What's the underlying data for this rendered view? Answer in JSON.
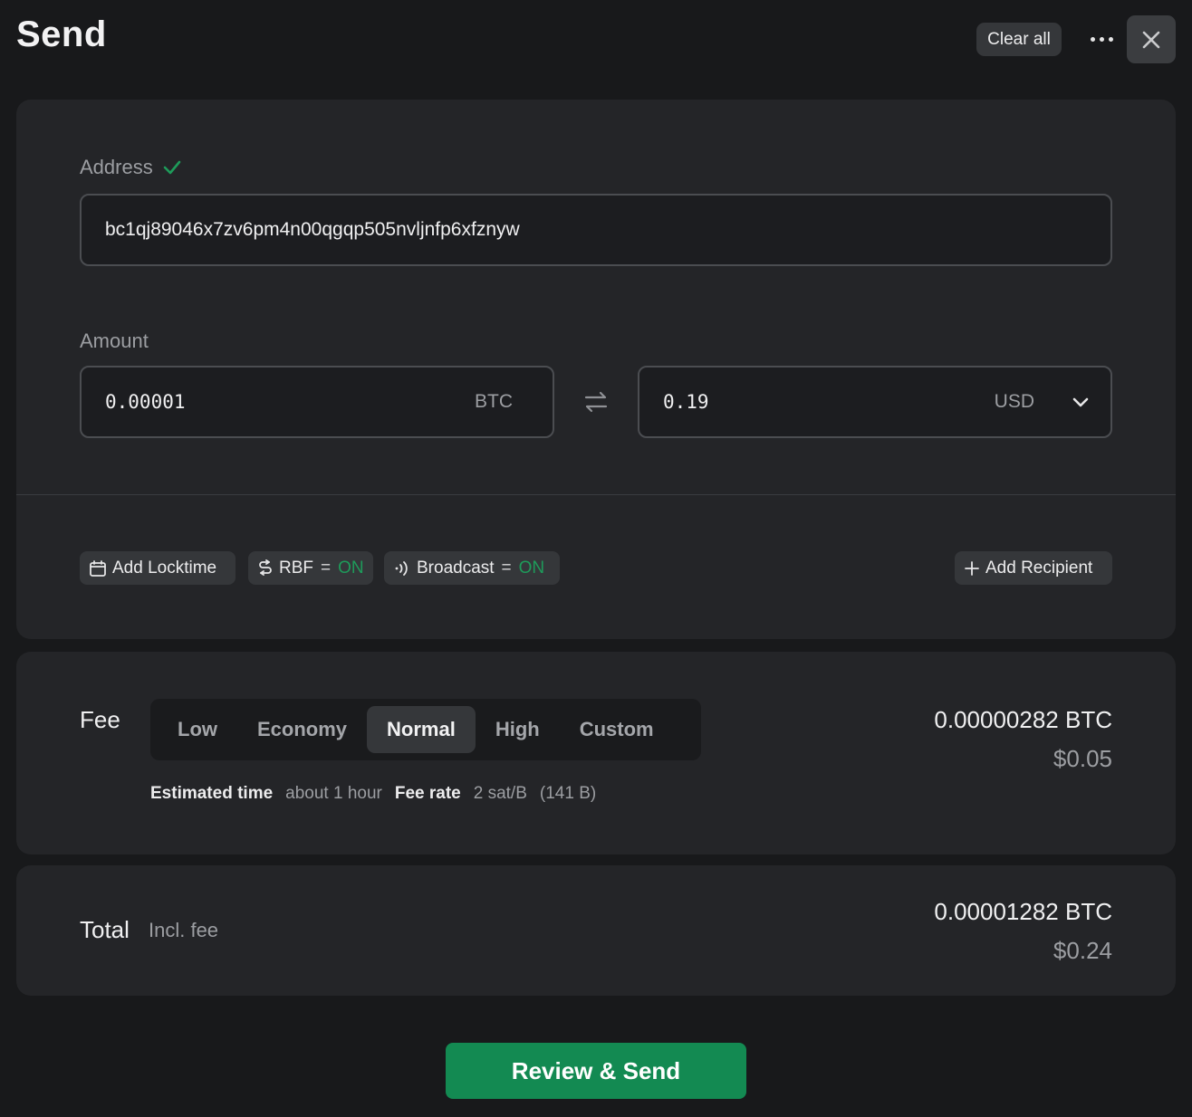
{
  "header": {
    "title": "Send",
    "clear_all_label": "Clear all"
  },
  "address": {
    "label": "Address",
    "value": "bc1qj89046x7zv6pm4n00qgqp505nvljnfp6xfznyw",
    "valid": true
  },
  "amount": {
    "label": "Amount",
    "btc_value": "0.00001",
    "btc_unit": "BTC",
    "fiat_value": "0.19",
    "fiat_unit": "USD"
  },
  "options": {
    "locktime_label": "Add Locktime",
    "rbf_label": "RBF",
    "rbf_eq": "=",
    "rbf_state": "ON",
    "broadcast_label": "Broadcast",
    "broadcast_eq": "=",
    "broadcast_state": "ON",
    "add_recipient_label": "Add Recipient"
  },
  "fee": {
    "title": "Fee",
    "levels": [
      "Low",
      "Economy",
      "Normal",
      "High",
      "Custom"
    ],
    "selected": "Normal",
    "estimated_time_label": "Estimated time",
    "estimated_time_value": "about 1 hour",
    "fee_rate_label": "Fee rate",
    "fee_rate_value": "2 sat/B",
    "tx_size": "(141 B)",
    "btc_amount": "0.00000282 BTC",
    "usd_amount": "$0.05"
  },
  "total": {
    "title": "Total",
    "subtitle": "Incl. fee",
    "btc_amount": "0.00001282 BTC",
    "usd_amount": "$0.24"
  },
  "actions": {
    "review_send_label": "Review & Send"
  },
  "colors": {
    "accent_green": "#138a52",
    "on_green": "#1e9b5a",
    "background": "#18191b",
    "card": "#242528"
  },
  "icons": [
    "check-icon",
    "more-icon",
    "close-icon",
    "swap-icon",
    "chevron-down-icon",
    "calendar-icon",
    "rbf-icon",
    "broadcast-icon",
    "plus-icon"
  ]
}
